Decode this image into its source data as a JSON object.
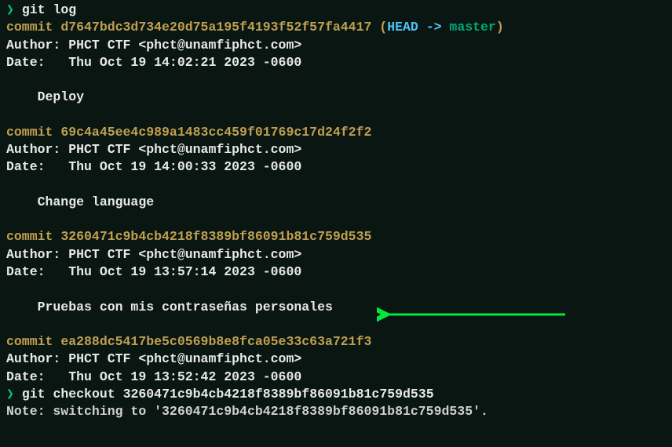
{
  "prompt": "❯",
  "cmd1": "git log",
  "commits": [
    {
      "commit_prefix": "commit ",
      "hash": "d7647bdc3d734e20d75a195f4193f52f57fa4417",
      "ref_open": " (",
      "head": "HEAD",
      "arrow": " -> ",
      "branch": "master",
      "ref_close": ")",
      "author_line": "Author: PHCT CTF <phct@unamfiphct.com>",
      "date_line": "Date:   Thu Oct 19 14:02:21 2023 -0600",
      "message": "    Deploy"
    },
    {
      "commit_prefix": "commit ",
      "hash": "69c4a45ee4c989a1483cc459f01769c17d24f2f2",
      "author_line": "Author: PHCT CTF <phct@unamfiphct.com>",
      "date_line": "Date:   Thu Oct 19 14:00:33 2023 -0600",
      "message": "    Change language"
    },
    {
      "commit_prefix": "commit ",
      "hash": "3260471c9b4cb4218f8389bf86091b81c759d535",
      "author_line": "Author: PHCT CTF <phct@unamfiphct.com>",
      "date_line": "Date:   Thu Oct 19 13:57:14 2023 -0600",
      "message": "    Pruebas con mis contraseñas personales"
    },
    {
      "commit_prefix": "commit ",
      "hash": "ea288dc5417be5c0569b8e8fca05e33c63a721f3",
      "author_line": "Author: PHCT CTF <phct@unamfiphct.com>",
      "date_line": "Date:   Thu Oct 19 13:52:42 2023 -0600"
    }
  ],
  "cmd2": "git checkout 3260471c9b4cb4218f8389bf86091b81c759d535",
  "note_line": "Note: switching to '3260471c9b4cb4218f8389bf86091b81c759d535'."
}
